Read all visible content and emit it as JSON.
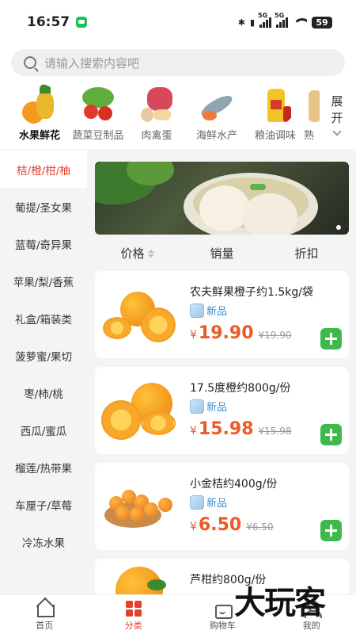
{
  "status_bar": {
    "time": "16:57",
    "signal1": "5G",
    "signal2": "5G",
    "battery": "59"
  },
  "search": {
    "placeholder": "请输入搜索内容吧"
  },
  "categories": [
    {
      "label": "水果鲜花",
      "icon": "fruit-icon",
      "active": true
    },
    {
      "label": "蔬菜豆制品",
      "icon": "vegetable-icon",
      "active": false
    },
    {
      "label": "肉禽蛋",
      "icon": "meat-icon",
      "active": false
    },
    {
      "label": "海鲜水产",
      "icon": "seafood-icon",
      "active": false
    },
    {
      "label": "粮油调味",
      "icon": "oil-icon",
      "active": false
    },
    {
      "label": "熟",
      "icon": "cooked-icon",
      "active": false
    }
  ],
  "expand_label": "展开",
  "sidebar": [
    {
      "label": "桔/橙/柑/柚",
      "active": true
    },
    {
      "label": "葡提/圣女果",
      "active": false
    },
    {
      "label": "蓝莓/奇异果",
      "active": false
    },
    {
      "label": "苹果/梨/香蕉",
      "active": false
    },
    {
      "label": "礼盒/箱装类",
      "active": false
    },
    {
      "label": "菠萝蜜/果切",
      "active": false
    },
    {
      "label": "枣/柿/桃",
      "active": false
    },
    {
      "label": "西瓜/蜜瓜",
      "active": false
    },
    {
      "label": "榴莲/热带果",
      "active": false
    },
    {
      "label": "车厘子/草莓",
      "active": false
    },
    {
      "label": "冷冻水果",
      "active": false
    }
  ],
  "sort": {
    "price": "价格",
    "sales": "销量",
    "discount": "折扣"
  },
  "products": [
    {
      "name": "农夫鲜果橙子约1.5kg/袋",
      "tag": "新品",
      "currency": "¥",
      "price": "19.90",
      "old_price": "¥19.90"
    },
    {
      "name": "17.5度橙约800g/份",
      "tag": "新品",
      "currency": "¥",
      "price": "15.98",
      "old_price": "¥15.98"
    },
    {
      "name": "小金桔约400g/份",
      "tag": "新品",
      "currency": "¥",
      "price": "6.50",
      "old_price": "¥6.50"
    },
    {
      "name": "芦柑约800g/份",
      "tag": "",
      "currency": "",
      "price": "",
      "old_price": ""
    }
  ],
  "tabs": [
    {
      "label": "首页",
      "icon": "home-icon"
    },
    {
      "label": "分类",
      "icon": "category-icon"
    },
    {
      "label": "购物车",
      "icon": "cart-icon"
    },
    {
      "label": "我的",
      "icon": "profile-icon"
    }
  ],
  "watermark": "大玩客",
  "colors": {
    "accent": "#e5402b",
    "price": "#ee5a24",
    "add": "#3dbb4a",
    "tag": "#3a8fd6"
  }
}
